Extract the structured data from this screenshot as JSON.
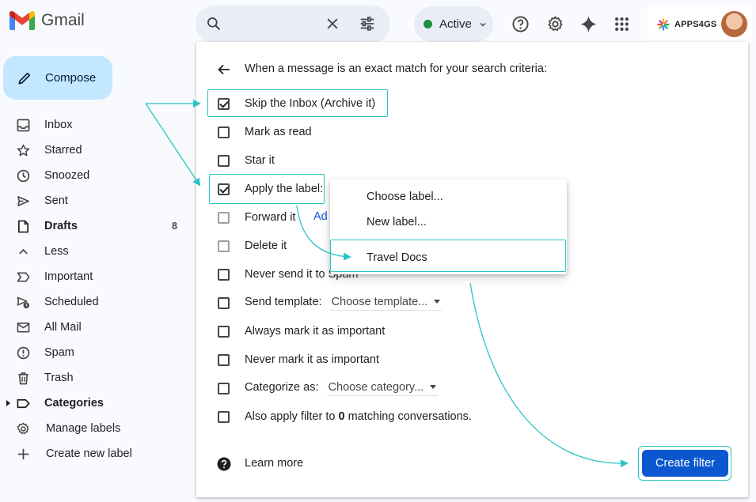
{
  "app": {
    "name": "Gmail"
  },
  "header": {
    "search_value": "",
    "status_label": "Active",
    "brand_label": "APPS4GS"
  },
  "compose_label": "Compose",
  "sidebar": {
    "items": [
      {
        "label": "Inbox",
        "icon": "inbox-icon"
      },
      {
        "label": "Starred",
        "icon": "star-icon"
      },
      {
        "label": "Snoozed",
        "icon": "clock-icon"
      },
      {
        "label": "Sent",
        "icon": "send-icon"
      },
      {
        "label": "Drafts",
        "icon": "draft-icon",
        "count": "8",
        "bold": true
      },
      {
        "label": "Less",
        "icon": "chevron-up-icon"
      },
      {
        "label": "Important",
        "icon": "important-icon"
      },
      {
        "label": "Scheduled",
        "icon": "scheduled-icon"
      },
      {
        "label": "All Mail",
        "icon": "all-mail-icon"
      },
      {
        "label": "Spam",
        "icon": "spam-icon"
      },
      {
        "label": "Trash",
        "icon": "trash-icon"
      },
      {
        "label": "Categories",
        "icon": "label-icon",
        "bold": true
      },
      {
        "label": "Manage labels",
        "icon": "gear-icon"
      },
      {
        "label": "Create new label",
        "icon": "plus-icon"
      }
    ]
  },
  "filter": {
    "title": "When a message is an exact match for your search criteria:",
    "options": {
      "skip_inbox": {
        "label": "Skip the Inbox (Archive it)",
        "checked": true
      },
      "mark_read": {
        "label": "Mark as read",
        "checked": false
      },
      "star": {
        "label": "Star it",
        "checked": false
      },
      "apply_label": {
        "label": "Apply the label:",
        "checked": true
      },
      "forward": {
        "label": "Forward it",
        "checked": false,
        "link": "Ad"
      },
      "delete": {
        "label": "Delete it",
        "checked": false
      },
      "never_spam": {
        "label": "Never send it to Spam",
        "checked": false
      },
      "send_template": {
        "label": "Send template:",
        "checked": false,
        "dropdown": "Choose template..."
      },
      "always_important": {
        "label": "Always mark it as important",
        "checked": false
      },
      "never_important": {
        "label": "Never mark it as important",
        "checked": false
      },
      "categorize": {
        "label": "Categorize as:",
        "checked": false,
        "dropdown": "Choose category..."
      },
      "also_apply": {
        "label_prefix": "Also apply filter to ",
        "count": "0",
        "label_suffix": " matching conversations.",
        "checked": false
      }
    },
    "label_menu": {
      "items": [
        "Choose label...",
        "New label...",
        "Travel Docs"
      ],
      "selected": "Travel Docs"
    },
    "learn_more": "Learn more",
    "create_button": "Create filter"
  },
  "colors": {
    "highlight": "#2bc4c4",
    "primary": "#0b57d0",
    "compose_bg": "#c2e7ff",
    "active_dot": "#1e8e3e"
  }
}
